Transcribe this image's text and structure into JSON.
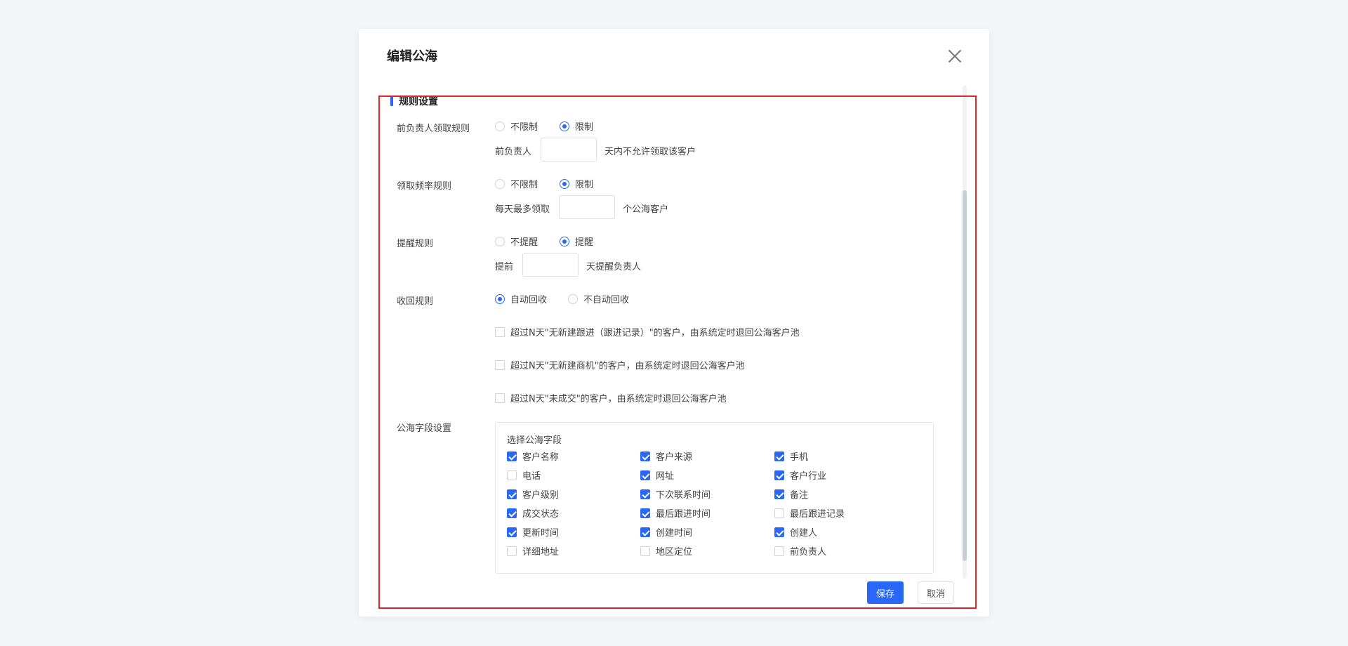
{
  "dialog": {
    "title": "编辑公海"
  },
  "section": {
    "title": "规则设置"
  },
  "rules": {
    "prev_owner": {
      "label": "前负责人领取规则",
      "option_unlimited": "不限制",
      "option_limited": "限制",
      "selected": "限制",
      "prefix": "前负责人",
      "value": "",
      "suffix": "天内不允许领取该客户"
    },
    "frequency": {
      "label": "领取频率规则",
      "option_unlimited": "不限制",
      "option_limited": "限制",
      "selected": "限制",
      "prefix": "每天最多领取",
      "value": "",
      "suffix": "个公海客户"
    },
    "remind": {
      "label": "提醒规则",
      "option_off": "不提醒",
      "option_on": "提醒",
      "selected": "提醒",
      "prefix": "提前",
      "value": "",
      "suffix": "天提醒负责人"
    },
    "recycle": {
      "label": "收回规则",
      "option_auto": "自动回收",
      "option_manual": "不自动回收",
      "selected": "自动回收",
      "conditions": [
        {
          "text": "超过N天\"无新建跟进（跟进记录）\"的客户，由系统定时退回公海客户池",
          "checked": false
        },
        {
          "text": "超过N天\"无新建商机\"的客户，由系统定时退回公海客户池",
          "checked": false
        },
        {
          "text": "超过N天\"未成交\"的客户，由系统定时退回公海客户池",
          "checked": false
        }
      ]
    }
  },
  "fields": {
    "label": "公海字段设置",
    "title": "选择公海字段",
    "items": [
      {
        "text": "客户名称",
        "checked": true
      },
      {
        "text": "客户来源",
        "checked": true
      },
      {
        "text": "手机",
        "checked": true
      },
      {
        "text": "电话",
        "checked": false
      },
      {
        "text": "网址",
        "checked": true
      },
      {
        "text": "客户行业",
        "checked": true
      },
      {
        "text": "客户级别",
        "checked": true
      },
      {
        "text": "下次联系时间",
        "checked": true
      },
      {
        "text": "备注",
        "checked": true
      },
      {
        "text": "成交状态",
        "checked": true
      },
      {
        "text": "最后跟进时间",
        "checked": true
      },
      {
        "text": "最后跟进记录",
        "checked": false
      },
      {
        "text": "更新时间",
        "checked": true
      },
      {
        "text": "创建时间",
        "checked": true
      },
      {
        "text": "创建人",
        "checked": true
      },
      {
        "text": "详细地址",
        "checked": false
      },
      {
        "text": "地区定位",
        "checked": false
      },
      {
        "text": "前负责人",
        "checked": false
      }
    ]
  },
  "buttons": {
    "save": "保存",
    "cancel": "取消"
  },
  "colors": {
    "accent": "#2968f6",
    "highlight": "#e0262c"
  }
}
